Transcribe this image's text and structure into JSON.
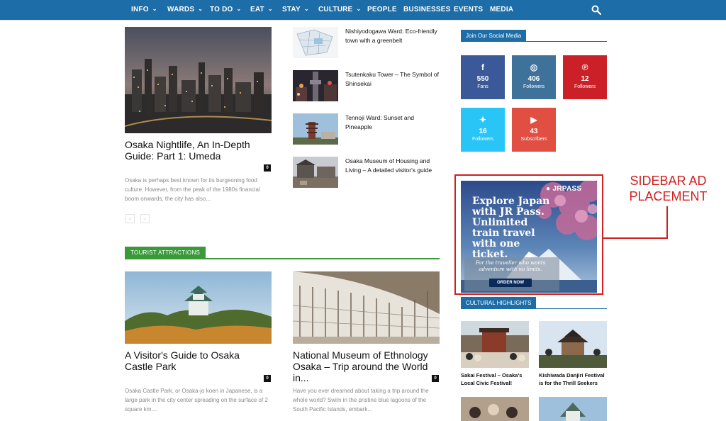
{
  "nav": {
    "items": [
      {
        "label": "INFO",
        "has_dropdown": true
      },
      {
        "label": "WARDS",
        "has_dropdown": true
      },
      {
        "label": "TO DO",
        "has_dropdown": true
      },
      {
        "label": "EAT",
        "has_dropdown": true
      },
      {
        "label": "STAY",
        "has_dropdown": true
      },
      {
        "label": "CULTURE",
        "has_dropdown": true
      },
      {
        "label": "PEOPLE",
        "has_dropdown": false
      },
      {
        "label": "BUSINESSES",
        "has_dropdown": false
      },
      {
        "label": "EVENTS",
        "has_dropdown": false
      },
      {
        "label": "MEDIA",
        "has_dropdown": false
      }
    ],
    "dropdown_glyph": "⌄",
    "search_icon": "search-icon",
    "bar_color": "#1c6da8"
  },
  "featured": {
    "title": "Osaka Nightlife, An In-Depth Guide: Part 1: Umeda",
    "comments": "0",
    "excerpt": "Osaka is perhaps best known for its burgeoning food culture. However, from the peak of the 1980s financial boom onwards, the city has also...",
    "pager_prev": "‹",
    "pager_next": "›"
  },
  "side_list": [
    {
      "title": "Nishiyodogawa Ward: Eco-friendly town with a greenbelt"
    },
    {
      "title": "Tsutenkaku Tower – The Symbol of Shinsekai"
    },
    {
      "title": "Tennoji Ward: Sunset and Pineapple"
    },
    {
      "title": "Osaka Museum of Housing and Living – A detailed visitor's guide"
    }
  ],
  "tourist": {
    "tag": "TOURIST ATTRACTIONS",
    "accent": "#3a9a3a",
    "posts": [
      {
        "title": "A Visitor's Guide to Osaka Castle Park",
        "comments": "0",
        "excerpt": "Osaka Castle Park, or Osaka-jo koen in Japanese, is a large park in the city center spreading on the surface of 2 square km...."
      },
      {
        "title": "National Museum of Ethnology Osaka – Trip around the World in...",
        "comments": "0",
        "excerpt": "Have you ever dreamed about taking a trip around the whole world? Swim in the pristine blue lagoons of the South Pacific Islands, embark..."
      }
    ]
  },
  "social": {
    "header": "Join Our Social Media",
    "items": [
      {
        "icon": "facebook-icon",
        "glyph": "f",
        "count": "550",
        "label": "Fans",
        "color": "#3b5998"
      },
      {
        "icon": "instagram-icon",
        "glyph": "◎",
        "count": "406",
        "label": "Followers",
        "color": "#3f729b"
      },
      {
        "icon": "pinterest-icon",
        "glyph": "℗",
        "count": "12",
        "label": "Followers",
        "color": "#cb2027"
      },
      {
        "icon": "twitter-icon",
        "glyph": "✦",
        "count": "16",
        "label": "Followers",
        "color": "#29c5f6"
      },
      {
        "icon": "youtube-icon",
        "glyph": "▶",
        "count": "43",
        "label": "Subscribers",
        "color": "#e14e42"
      }
    ]
  },
  "ad": {
    "annotation": "SIDEBAR AD PLACEMENT",
    "logo": "● JRPASS",
    "headline": "Explore Japan with JR Pass. Unlimited train travel with one ticket.",
    "subline": "For the traveller who wants adventure with no limits.",
    "cta": "ORDER NOW",
    "annotation_color": "#d21f1f"
  },
  "cultural": {
    "header": "CULTURAL HIGHLIGHTS",
    "items": [
      {
        "title": "Sakai Festival – Osaka's Local Civic Festival!"
      },
      {
        "title": "Kishiwada Danjiri Festival is for the Thrill Seekers"
      }
    ]
  }
}
